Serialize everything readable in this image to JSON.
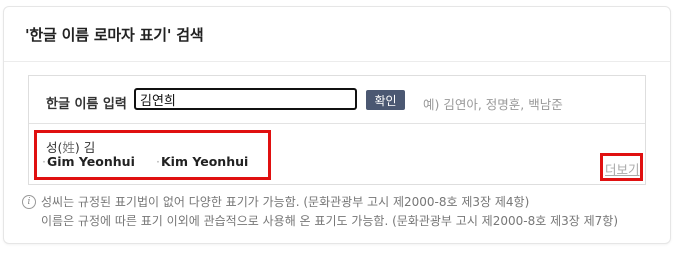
{
  "panel": {
    "title": "'한글 이름 로마자 표기' 검색"
  },
  "search": {
    "label": "한글 이름 입력",
    "value": "김연희",
    "button_label": "확인",
    "example": "예) 김연아, 정명훈, 백남준"
  },
  "result": {
    "surname_prefix": "성(",
    "surname_hanja": "姓",
    "surname_suffix": ") 김",
    "romanizations": [
      "Gim Yeonhui",
      "Kim Yeonhui"
    ],
    "more_label": "더보기"
  },
  "notes": {
    "icon": "info-icon",
    "lines": [
      "성씨는 규정된 표기법이 없어 다양한 표기가 가능함. (문화관광부 고시 제2000-8호 제3장 제4항)",
      "이름은 규정에 따른 표기 이외에 관습적으로 사용해 온 표기도 가능함. (문화관광부 고시 제2000-8호 제3장 제7항)"
    ]
  },
  "colors": {
    "button_bg": "#4b5872",
    "highlight_border": "#e01010"
  }
}
